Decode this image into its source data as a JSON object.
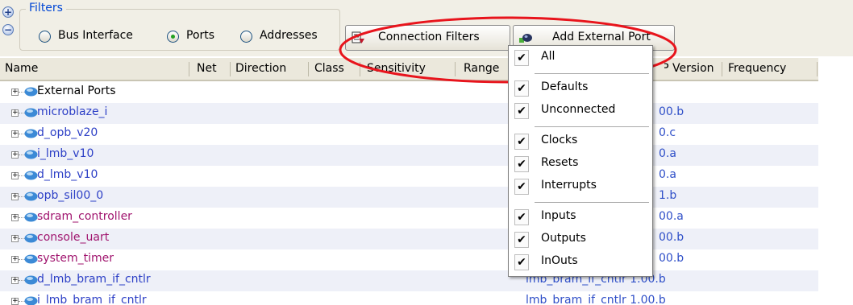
{
  "filters": {
    "legend": "Filters",
    "expand_icon": "plus-icon",
    "collapse_icon": "minus-icon",
    "options": [
      {
        "label": "Bus Interface",
        "selected": false
      },
      {
        "label": "Ports",
        "selected": true
      },
      {
        "label": "Addresses",
        "selected": false
      }
    ]
  },
  "toolbar": {
    "connection_filters_label": "Connection Filters",
    "connection_filters_icon": "filter-icon",
    "add_external_port_label": "Add External Port",
    "add_external_port_icon": "add-port-icon"
  },
  "table": {
    "columns": [
      "Name",
      "Net",
      "Direction",
      "Class",
      "Sensitivity",
      "Range",
      "IP Version",
      "Frequency"
    ],
    "rows": [
      {
        "name": "External Ports",
        "version": "",
        "name_color": "#000000"
      },
      {
        "name": "microblaze_i",
        "version": "00.b",
        "name_color": "#2c3fc6"
      },
      {
        "name": "d_opb_v20",
        "version": "0.c",
        "name_color": "#2c3fc6"
      },
      {
        "name": "i_lmb_v10",
        "version": "0.a",
        "name_color": "#2c3fc6"
      },
      {
        "name": "d_lmb_v10",
        "version": "0.a",
        "name_color": "#2c3fc6"
      },
      {
        "name": "opb_sil00_0",
        "version": "1.b",
        "name_color": "#2c3fc6"
      },
      {
        "name": "sdram_controller",
        "version": "00.a",
        "name_color": "#a0146e"
      },
      {
        "name": "console_uart",
        "version": "00.b",
        "name_color": "#a0146e"
      },
      {
        "name": "system_timer",
        "version": "00.b",
        "name_color": "#a0146e"
      },
      {
        "name": "d_lmb_bram_if_cntlr",
        "version": "lmb_bram_if_cntlr 1.00.b",
        "name_color": "#2c3fc6"
      },
      {
        "name": "i_lmb_bram_if_cntlr",
        "version": "lmb_bram_if_cntlr 1.00.b",
        "name_color": "#2c3fc6"
      }
    ]
  },
  "menu": {
    "groups": [
      [
        {
          "label": "All",
          "checked": true
        }
      ],
      [
        {
          "label": "Defaults",
          "checked": true
        },
        {
          "label": "Unconnected",
          "checked": true
        }
      ],
      [
        {
          "label": "Clocks",
          "checked": true
        },
        {
          "label": "Resets",
          "checked": true
        },
        {
          "label": "Interrupts",
          "checked": true
        }
      ],
      [
        {
          "label": "Inputs",
          "checked": true
        },
        {
          "label": "Outputs",
          "checked": true
        },
        {
          "label": "InOuts",
          "checked": true
        }
      ]
    ],
    "check_glyph": "✔"
  },
  "colors": {
    "highlight_ellipse": "#e8141c",
    "node_icon": "#3c8ad6",
    "accent_blue": "#0046d5"
  }
}
